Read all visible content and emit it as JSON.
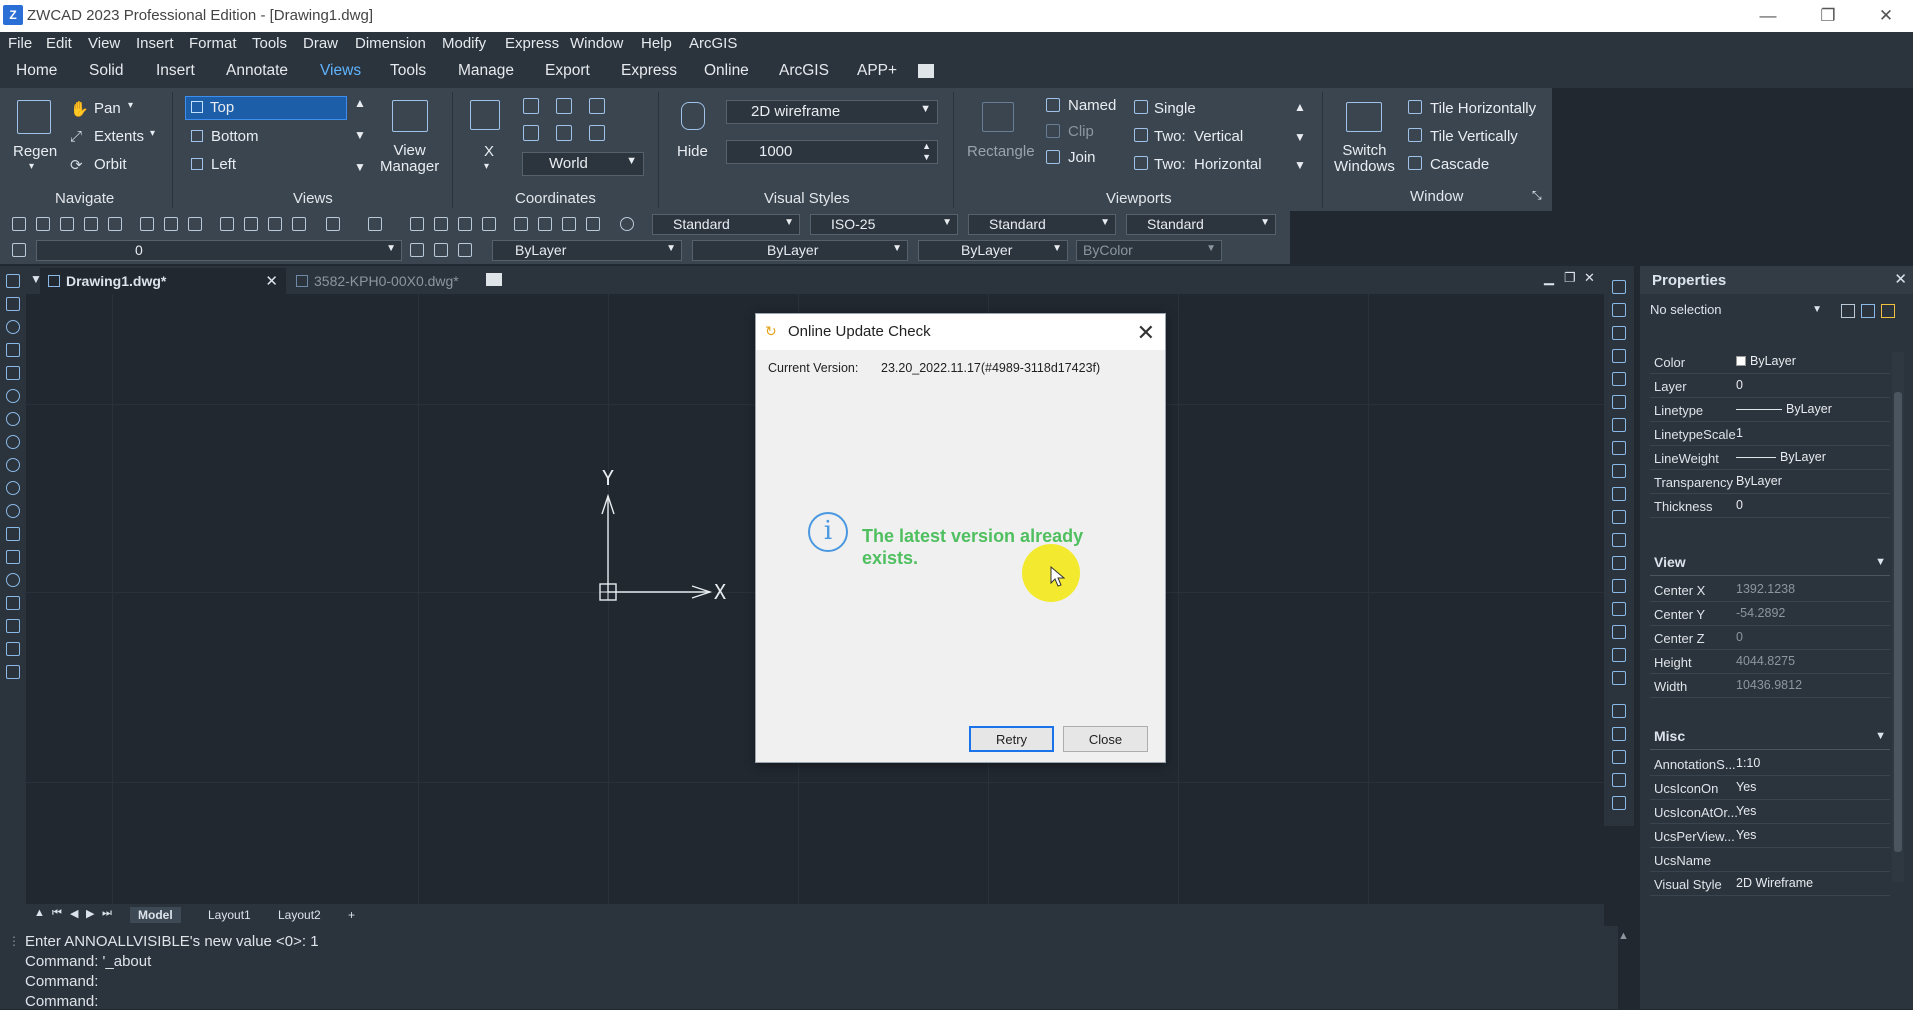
{
  "window": {
    "title": "ZWCAD 2023 Professional Edition - [Drawing1.dwg]",
    "app_icon": "Z",
    "controls": [
      "—",
      "❐",
      "✕"
    ]
  },
  "menu": [
    "File",
    "Edit",
    "View",
    "Insert",
    "Format",
    "Tools",
    "Draw",
    "Dimension",
    "Modify",
    "Express",
    "Window",
    "Help",
    "ArcGIS"
  ],
  "ribbon_tabs": [
    {
      "label": "Home",
      "active": false
    },
    {
      "label": "Solid",
      "active": false
    },
    {
      "label": "Insert",
      "active": false
    },
    {
      "label": "Annotate",
      "active": false
    },
    {
      "label": "Views",
      "active": true
    },
    {
      "label": "Tools",
      "active": false
    },
    {
      "label": "Manage",
      "active": false
    },
    {
      "label": "Export",
      "active": false
    },
    {
      "label": "Express",
      "active": false
    },
    {
      "label": "Online",
      "active": false
    },
    {
      "label": "ArcGIS",
      "active": false
    },
    {
      "label": "APP+",
      "active": false
    }
  ],
  "ribbon": {
    "navigate": {
      "title": "Navigate",
      "regen": "Regen",
      "pan": "Pan",
      "extents": "Extents",
      "orbit": "Orbit"
    },
    "views": {
      "title": "Views",
      "items": [
        "Top",
        "Bottom",
        "Left"
      ],
      "view_manager": "View\nManager"
    },
    "coordinates": {
      "title": "Coordinates",
      "x_label": "X",
      "ucs_combo": "World"
    },
    "visual_styles": {
      "title": "Visual Styles",
      "hide": "Hide",
      "style_combo": "2D wireframe",
      "spin_value": "1000"
    },
    "viewports": {
      "title": "Viewports",
      "rectangle": "Rectangle",
      "named": "Named",
      "clip": "Clip",
      "join": "Join",
      "single": "Single",
      "two_vertical": "Two:  Vertical",
      "two_horizontal": "Two:  Horizontal"
    },
    "window": {
      "title": "Window",
      "switch_windows": "Switch\nWindows",
      "tile_horizontally": "Tile Horizontally",
      "tile_vertically": "Tile Vertically",
      "cascade": "Cascade"
    }
  },
  "toolbar1": {
    "text_style": "Standard",
    "dim_style": "ISO-25",
    "table_style": "Standard",
    "mleader_style": "Standard"
  },
  "toolbar2": {
    "layer": "0",
    "color": "ByLayer",
    "linetype": "ByLayer",
    "lineweight": "ByLayer",
    "plotstyle": "ByColor"
  },
  "doc_tabs": [
    {
      "label": "Drawing1.dwg*",
      "active": true,
      "close": "✕"
    },
    {
      "label": "3582-KPH0-00X0.dwg*",
      "active": false
    }
  ],
  "ucs": {
    "y": "Y",
    "x": "X"
  },
  "layout_tabs": [
    {
      "label": "Model",
      "active": true
    },
    {
      "label": "Layout1",
      "active": false
    },
    {
      "label": "Layout2",
      "active": false
    },
    {
      "label": "+",
      "active": false
    }
  ],
  "command_lines": [
    "Enter ANNOALLVISIBLE's new value  <0>: 1",
    "Command: '_about",
    "Command:",
    "Command:"
  ],
  "properties": {
    "title": "Properties",
    "selection": "No selection",
    "general": [
      {
        "k": "Color",
        "v": "ByLayer"
      },
      {
        "k": "Layer",
        "v": "0"
      },
      {
        "k": "Linetype",
        "v": "ByLayer"
      },
      {
        "k": "LinetypeScale",
        "v": "1"
      },
      {
        "k": "LineWeight",
        "v": "ByLayer"
      },
      {
        "k": "Transparency",
        "v": "ByLayer"
      },
      {
        "k": "Thickness",
        "v": "0"
      }
    ],
    "view_title": "View",
    "view": [
      {
        "k": "Center X",
        "v": "1392.1238"
      },
      {
        "k": "Center Y",
        "v": "-54.2892"
      },
      {
        "k": "Center Z",
        "v": "0"
      },
      {
        "k": "Height",
        "v": "4044.8275"
      },
      {
        "k": "Width",
        "v": "10436.9812"
      }
    ],
    "misc_title": "Misc",
    "misc": [
      {
        "k": "AnnotationS...",
        "v": "1:10"
      },
      {
        "k": "UcsIconOn",
        "v": "Yes"
      },
      {
        "k": "UcsIconAtOr...",
        "v": "Yes"
      },
      {
        "k": "UcsPerView...",
        "v": "Yes"
      },
      {
        "k": "UcsName",
        "v": ""
      },
      {
        "k": "Visual Style",
        "v": "2D Wireframe"
      }
    ]
  },
  "dialog": {
    "title": "Online Update Check",
    "version_label": "Current Version:",
    "version_value": "23.20_2022.11.17(#4989-3118d17423f)",
    "info_glyph": "i",
    "message": "The latest version already exists.",
    "retry": "Retry",
    "close": "Close",
    "close_x": "✕"
  },
  "colors": {
    "accent": "#5fb3ff",
    "message": "#4fbf5f",
    "highlight": "#f3e91a"
  }
}
